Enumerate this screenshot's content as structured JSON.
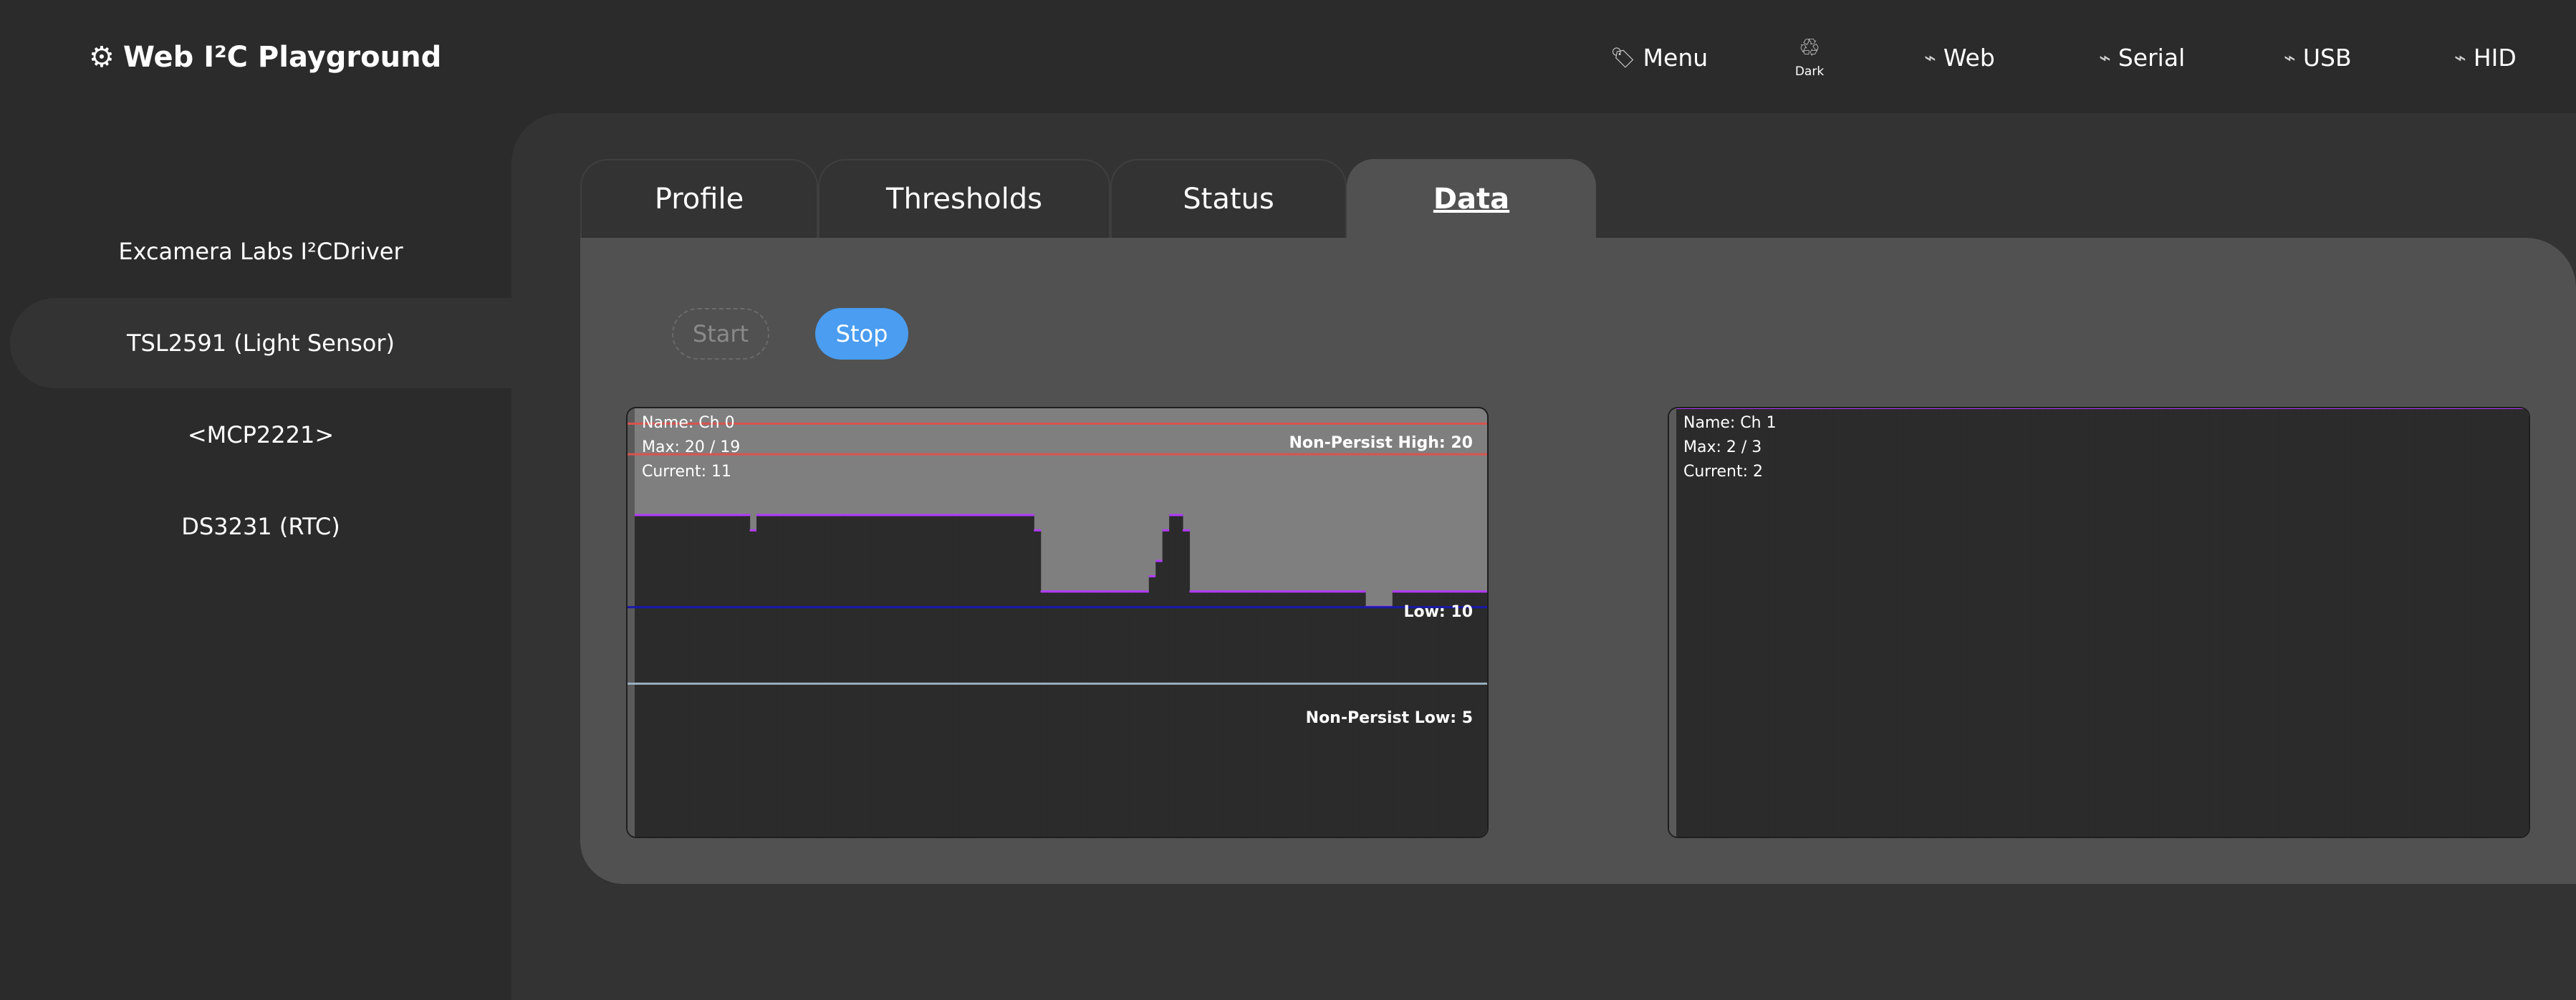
{
  "header": {
    "title": "Web I²C Playground"
  },
  "nav": {
    "menu": "Menu",
    "dark": "Dark",
    "web": "Web",
    "serial": "Serial",
    "usb": "USB",
    "hid": "HID"
  },
  "icons": {
    "logo": "gear-icon",
    "menu": "tag-icon",
    "dark": "recycle-icon",
    "connection": "plug-icon"
  },
  "sidebar": {
    "items": [
      {
        "label": "Excamera Labs I²CDriver",
        "selected": false
      },
      {
        "label": "TSL2591 (Light Sensor)",
        "selected": true
      },
      {
        "label": "<MCP2221>",
        "selected": false
      },
      {
        "label": "DS3231 (RTC)",
        "selected": false
      }
    ]
  },
  "tabs": [
    {
      "label": "Profile",
      "active": false
    },
    {
      "label": "Thresholds",
      "active": false
    },
    {
      "label": "Status",
      "active": false
    },
    {
      "label": "Data",
      "active": true
    }
  ],
  "buttons": {
    "start": "Start",
    "stop": "Stop"
  },
  "colors": {
    "accent": "#4a9df0",
    "threshold_high": "#d9534f",
    "threshold_low": "#1a1aa8",
    "np_low": "#9ab0c0",
    "max_marker": "#b23bff"
  },
  "charts": [
    {
      "name": "Name: Ch 0",
      "max": "Max: 20 / 19",
      "current": "Current: 11",
      "np_high_label": "Non-Persist High: 20",
      "low_label": "Low: 10",
      "np_low_label": "Non-Persist Low: 5"
    },
    {
      "name": "Name: Ch 1",
      "max": "Max: 2 / 3",
      "current": "Current: 2"
    }
  ],
  "chart_data": [
    {
      "type": "area",
      "title": "Name: Ch 0",
      "ylim": [
        -5,
        23
      ],
      "high_threshold": 22,
      "non_persist_high": 20,
      "low_threshold": 10,
      "non_persist_low": 5,
      "series": [
        {
          "values": [
            16,
            16,
            16,
            16,
            16,
            16,
            16,
            16,
            16,
            16,
            16,
            16,
            16,
            16,
            16,
            16,
            16,
            15,
            16,
            16,
            16,
            16,
            16,
            16,
            16,
            16,
            16,
            16,
            16,
            16,
            16,
            16,
            16,
            16,
            16,
            16,
            16,
            16,
            16,
            16,
            16,
            16,
            16,
            16,
            16,
            16,
            16,
            16,
            16,
            16,
            16,
            16,
            16,
            16,
            16,
            16,
            16,
            16,
            16,
            15,
            11,
            11,
            11,
            11,
            11,
            11,
            11,
            11,
            11,
            11,
            11,
            11,
            11,
            11,
            11,
            11,
            12,
            13,
            15,
            16,
            16,
            15,
            11,
            11,
            11,
            11,
            11,
            11,
            11,
            11,
            11,
            11,
            11,
            11,
            11,
            11,
            11,
            11,
            11,
            11,
            11,
            11,
            11,
            11,
            11,
            11,
            11,
            11,
            10,
            10,
            10,
            10,
            11,
            11,
            11,
            11,
            11,
            11,
            11,
            11,
            11,
            11,
            11,
            11,
            11,
            11
          ]
        }
      ]
    },
    {
      "type": "area",
      "title": "Name: Ch 1",
      "ylim": [
        -5,
        3
      ],
      "series": [
        {
          "values": [
            3,
            3,
            3,
            3,
            3,
            3,
            3,
            3,
            3,
            3,
            3,
            3,
            3,
            3,
            3,
            3,
            3,
            3,
            3,
            3,
            3,
            3,
            3,
            3,
            3,
            3,
            3,
            3,
            3,
            3,
            3,
            3,
            3,
            3,
            3,
            3,
            3,
            3,
            3,
            3,
            3,
            3,
            3,
            3,
            3,
            3,
            3,
            3,
            3,
            3,
            3,
            3,
            3,
            3,
            3,
            3,
            3,
            3,
            3,
            3,
            3,
            3,
            3,
            3,
            3,
            3,
            3,
            3,
            3,
            3,
            3,
            3,
            3,
            3,
            3,
            3,
            3,
            3,
            3,
            3,
            3,
            3,
            3,
            3,
            3,
            3,
            3,
            3,
            3,
            3,
            3,
            3,
            3,
            3,
            3,
            3,
            3,
            3,
            3,
            3,
            3,
            3,
            3,
            3,
            3,
            3,
            3,
            3,
            3,
            3,
            3,
            3,
            3,
            3,
            3,
            3,
            3,
            3,
            3,
            3
          ]
        }
      ]
    }
  ]
}
